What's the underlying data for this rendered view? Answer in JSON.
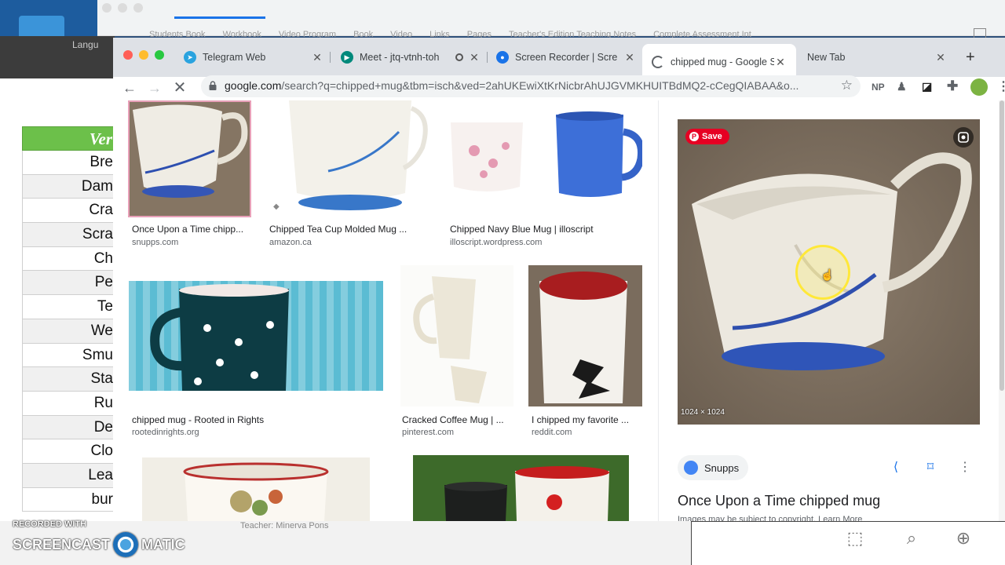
{
  "background": {
    "doc_tab": "Langu",
    "bg_tabs": [
      "Students Book",
      "Workbook",
      "Video Program",
      "Book",
      "Video",
      "Links",
      "Pages",
      "Teacher's Edition Teaching Notes",
      "Complete Assessment Int"
    ],
    "sheet_header": "Ver",
    "sheet_rows": [
      "Bre",
      "Dam",
      "Cra",
      "Scra",
      "Ch",
      "Pe",
      "Te",
      "We",
      "Smu",
      "Sta",
      "Ru",
      "De",
      "Clo",
      "Lea",
      "bur"
    ],
    "teacher": "Teacher: Minerva Pons"
  },
  "watermark": {
    "line1": "RECORDED WITH",
    "line2a": "SCREENCAST",
    "line2b": "MATIC"
  },
  "tabs": [
    {
      "label": "Telegram Web",
      "icon": "telegram-icon",
      "color": "#2aa3df"
    },
    {
      "label": "Meet - jtq-vtnh-toh",
      "icon": "meet-icon",
      "color": "#00897b"
    },
    {
      "label": "Screen Recorder | Scre",
      "icon": "recorder-icon",
      "color": "#1a73e8"
    },
    {
      "label": "chipped mug - Google S",
      "icon": "loading-icon",
      "color": "#5f6368",
      "active": true
    },
    {
      "label": "New Tab",
      "icon": "",
      "color": ""
    }
  ],
  "toolbar": {
    "url_host": "google.com",
    "url_rest": "/search?q=chipped+mug&tbm=isch&ved=2ahUKEwiXtKrNicbrAhUJGVMKHUITBdMQ2-cCegQIABAA&o...",
    "ext_np": "NP"
  },
  "results": [
    {
      "title": "Once Upon a Time chipp...",
      "source": "snupps.com"
    },
    {
      "title": "Chipped Tea Cup Molded Mug ...",
      "source": "amazon.ca"
    },
    {
      "title": "Chipped Navy Blue Mug | illoscript",
      "source": "illoscript.wordpress.com"
    },
    {
      "title": "chipped mug - Rooted in Rights",
      "source": "rootedinrights.org"
    },
    {
      "title": "Cracked Coffee Mug | ...",
      "source": "pinterest.com"
    },
    {
      "title": "I chipped my favorite ...",
      "source": "reddit.com"
    }
  ],
  "panel": {
    "save_label": "Save",
    "dimensions": "1024 × 1024",
    "source_name": "Snupps",
    "title": "Once Upon a Time chipped mug",
    "note": "Images may be subject to copyright. Learn More"
  },
  "colors": {
    "accent": "#1a73e8",
    "pinterest": "#e60023",
    "sheet_header": "#6cc04a"
  }
}
